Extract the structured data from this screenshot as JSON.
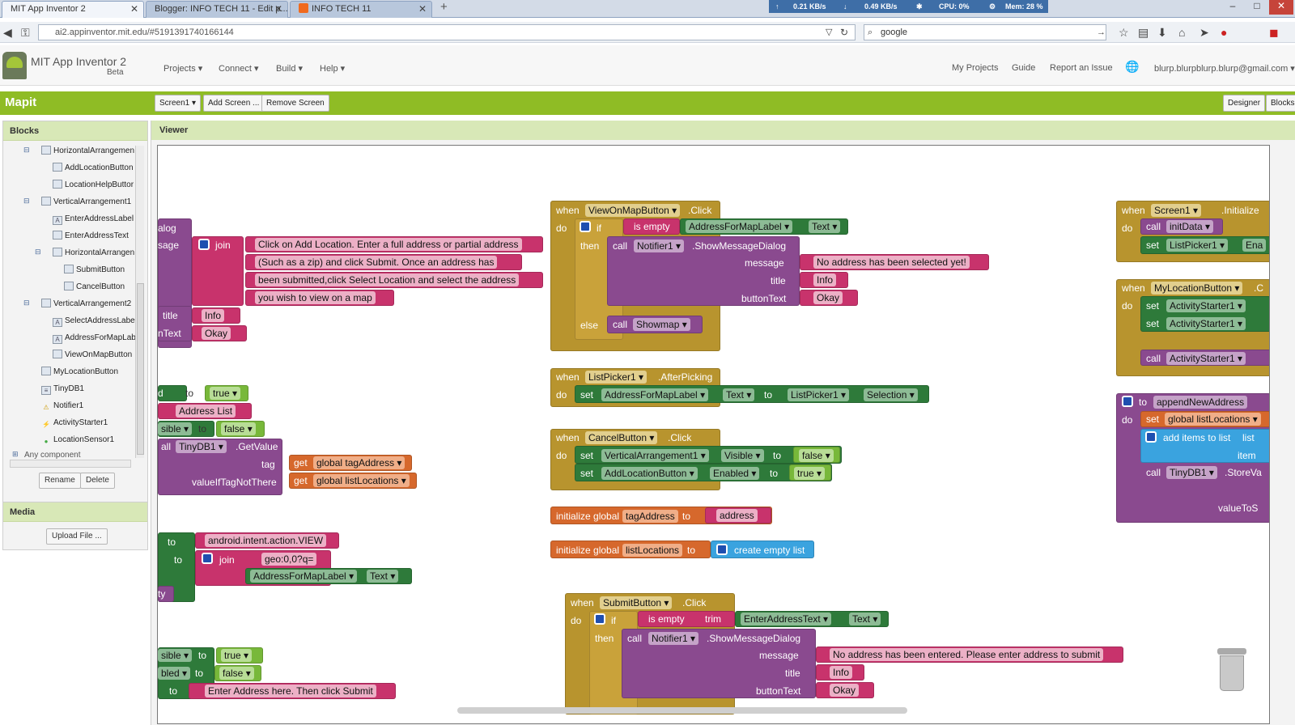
{
  "browser": {
    "tabs": [
      {
        "label": "MIT App Inventor 2"
      },
      {
        "label": "Blogger: INFO TECH 11 - Edit p..."
      },
      {
        "label": "INFO TECH 11"
      }
    ],
    "sys": {
      "up": "0.21 KB/s",
      "down": "0.49 KB/s",
      "cpu": "CPU: 0%",
      "mem": "Mem: 28 %"
    },
    "url": "ai2.appinventor.mit.edu/#5191391740166144",
    "search": "google"
  },
  "header": {
    "app_title": "MIT App Inventor 2",
    "beta": "Beta",
    "menus": [
      "Projects",
      "Connect",
      "Build",
      "Help"
    ],
    "links": [
      "My Projects",
      "Guide",
      "Report an Issue"
    ],
    "user": "blurp.blurpblurp.blurp@gmail.com"
  },
  "toolbar": {
    "project": "Mapit",
    "screen": "Screen1",
    "add_screen": "Add Screen ...",
    "remove_screen": "Remove Screen",
    "designer": "Designer",
    "blocks": "Blocks"
  },
  "blocks_panel": {
    "title": "Blocks",
    "tree": [
      "HorizontalArrangemen",
      "AddLocationButton",
      "LocationHelpButtor",
      "VerticalArrangement1",
      "EnterAddressLabel",
      "EnterAddressText",
      "HorizontalArrangen",
      "SubmitButton",
      "CancelButton",
      "VerticalArrangement2",
      "SelectAddressLabe",
      "AddressForMapLab",
      "ViewOnMapButton",
      "MyLocationButton",
      "TinyDB1",
      "Notifier1",
      "ActivityStarter1",
      "LocationSensor1",
      "Any component"
    ],
    "rename": "Rename",
    "delete": "Delete"
  },
  "media": {
    "title": "Media",
    "upload": "Upload File ..."
  },
  "viewer": {
    "title": "Viewer"
  },
  "workspace": {
    "left": {
      "dialog": "alog",
      "message": "sage",
      "join": "join",
      "texts": [
        "Click on Add Location. Enter a full address or partial address",
        "(Such as a zip) and click Submit. Once an address has",
        "been submitted,click Select Location and select the address",
        "you wish to view on a map"
      ],
      "title": "title",
      "info": "Info",
      "buttonText": "nText",
      "okay": "Okay",
      "b2_set": "d",
      "to": "to",
      "true": "true",
      "addr_list": "Address List",
      "sible": "sible",
      "false": "false",
      "call_all": "all",
      "tinydb": "TinyDB1",
      "getvalue": ".GetValue",
      "tag": "tag",
      "get": "get",
      "tagAddress": "global tagAddress",
      "valueIf": "valueIfTagNotThere",
      "listLocations": "global listLocations",
      "intent": "android.intent.action.VIEW",
      "geo": "geo:0,0?q=",
      "afml": "AddressForMapLabel",
      "text": "Text",
      "ty": "ty",
      "sible2": "sible",
      "bled": "bled",
      "enter_addr": "Enter Address here. Then click Submit"
    },
    "view_on_map": {
      "when": "when",
      "comp": "ViewOnMapButton",
      "event": ".Click",
      "do": "do",
      "if": "if",
      "is_empty": "is empty",
      "afml": "AddressForMapLabel",
      "text": "Text",
      "then": "then",
      "call": "call",
      "notifier": "Notifier1",
      "smd": ".ShowMessageDialog",
      "message": "message",
      "msg": "No address has been selected yet!",
      "title": "title",
      "info": "Info",
      "buttonText": "buttonText",
      "okay": "Okay",
      "else": "else",
      "showmap": "Showmap"
    },
    "listpicker": {
      "when": "when",
      "comp": "ListPicker1",
      "event": ".AfterPicking",
      "do": "do",
      "set": "set",
      "afml": "AddressForMapLabel",
      "text": "Text",
      "to": "to",
      "lp": "ListPicker1",
      "sel": "Selection"
    },
    "cancel": {
      "when": "when",
      "comp": "CancelButton",
      "event": ".Click",
      "do": "do",
      "set": "set",
      "va1": "VerticalArrangement1",
      "visible": "Visible",
      "to": "to",
      "false": "false",
      "alb": "AddLocationButton",
      "enabled": "Enabled",
      "true": "true"
    },
    "globals": {
      "init": "initialize global",
      "tagAddress": "tagAddress",
      "to": "to",
      "address": "address",
      "listLocations": "listLocations",
      "cel": "create empty list"
    },
    "submit": {
      "when": "when",
      "comp": "SubmitButton",
      "event": ".Click",
      "do": "do",
      "if": "if",
      "is_empty": "is empty",
      "trim": "trim",
      "eat": "EnterAddressText",
      "text": "Text",
      "then": "then",
      "call": "call",
      "notifier": "Notifier1",
      "smd": ".ShowMessageDialog",
      "message": "message",
      "msg": "No address has been entered. Please enter address to submit",
      "title": "title",
      "info": "Info",
      "buttonText": "buttonText",
      "okay": "Okay"
    },
    "right": {
      "when": "when",
      "screen": "Screen1",
      "init": ".Initialize",
      "do": "do",
      "call": "call",
      "initData": "initData",
      "set": "set",
      "lp": "ListPicker1",
      "ena": "Ena",
      "myloc": "MyLocationButton",
      "c": ".C",
      "as1": "ActivityStarter1",
      "to": "to",
      "append": "appendNewAddress",
      "gll": "global listLocations",
      "additems": "add items to list",
      "list": "list",
      "item": "item",
      "tinydb": "TinyDB1",
      "storev": ".StoreVa",
      "valueTo": "valueToS"
    }
  }
}
